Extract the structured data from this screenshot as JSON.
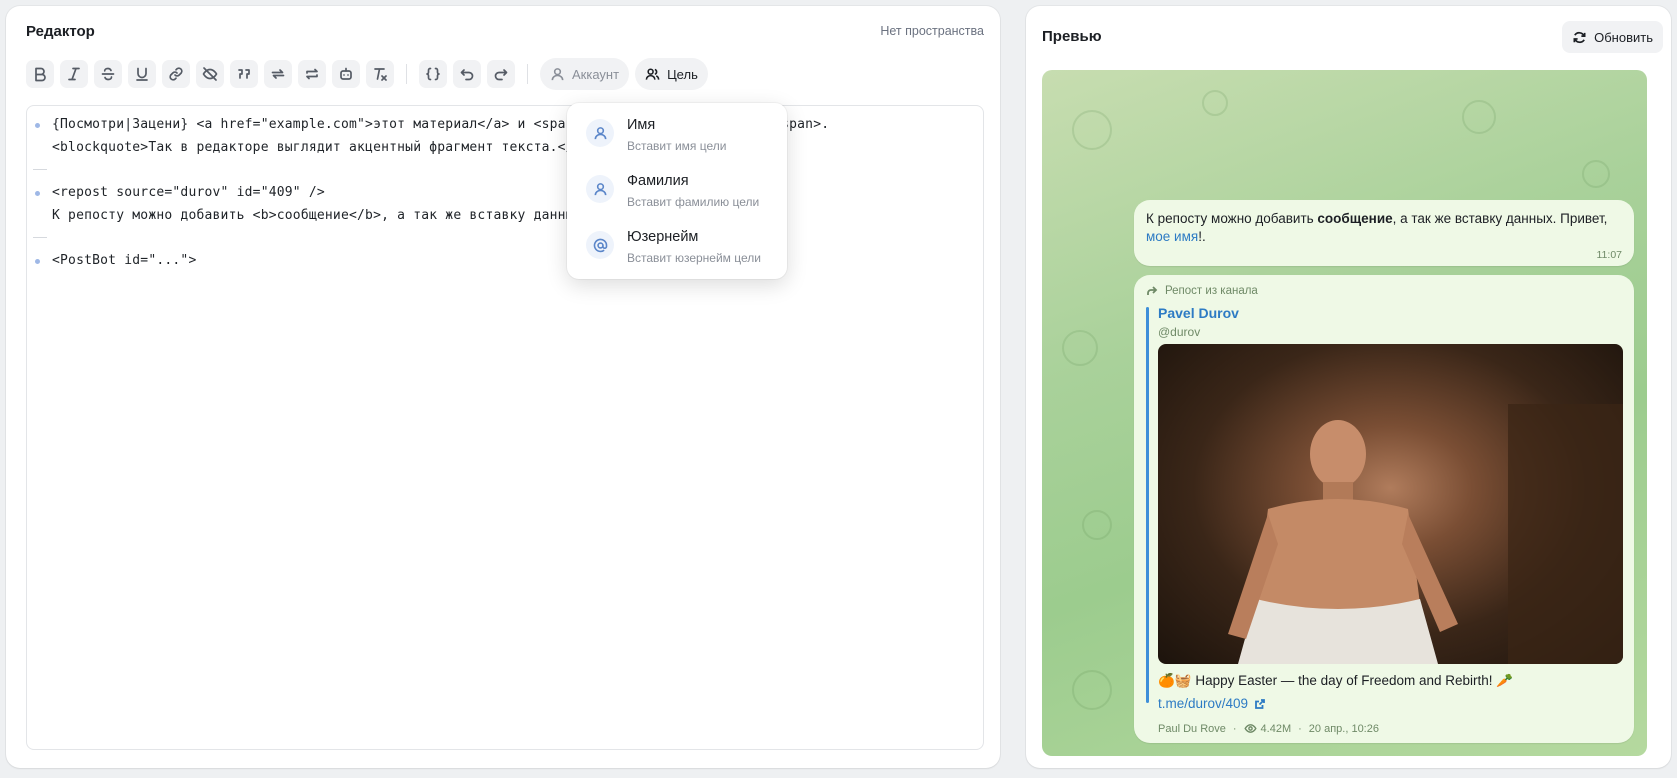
{
  "editor": {
    "title": "Редактор",
    "space_label": "Нет пространства",
    "toolbar": {
      "buttons": [
        "bold-icon",
        "italic-icon",
        "strikethrough-icon",
        "underline-icon",
        "link-icon",
        "spoiler-icon",
        "quote-icon",
        "repost-icon",
        "repost-alt-icon",
        "bot-icon",
        "clear-format-icon",
        "code-icon",
        "undo-icon",
        "redo-icon"
      ],
      "account_label": "Аккаунт",
      "target_label": "Цель"
    },
    "lines": [
      "{Посмотри|Зацени} <a href=\"example.com\">этот материал</a> и <span",
      "ок</span>.",
      "<blockquote>Так в редакторе выглядит акцентный фрагмент текста.</b",
      "<repost source=\"durov\" id=\"409\" />",
      "К репосту можно добавить <b>сообщение</b>, а так же вставку данных",
      "<PostBot id=\"...\">"
    ]
  },
  "dropdown": {
    "items": [
      {
        "title": "Имя",
        "subtitle": "Вставит имя цели",
        "icon": "user-icon"
      },
      {
        "title": "Фамилия",
        "subtitle": "Вставит фамилию цели",
        "icon": "user-icon"
      },
      {
        "title": "Юзернейм",
        "subtitle": "Вставит юзернейм цели",
        "icon": "at-icon"
      }
    ]
  },
  "preview": {
    "title": "Превью",
    "refresh_label": "Обновить",
    "message": {
      "text_before": "К репосту можно добавить ",
      "bold": "сообщение",
      "text_after": ", а так же вставку данных. Привет,",
      "link": "мое имя",
      "text_end": "!.",
      "time": "11:07"
    },
    "repost": {
      "label": "Репост из канала",
      "author": "Pavel Durov",
      "handle": "@durov",
      "caption": "🍊🧺 Happy Easter — the day of Freedom and Rebirth! 🥕",
      "link": "t.me/durov/409",
      "signature": "Paul Du Rove",
      "views": "4.42M",
      "date": "20 апр., 10:26"
    }
  },
  "colors": {
    "accent": "#2d7bc4",
    "chat_bg": "#a9d19a",
    "bubble": "#eff9e6"
  }
}
